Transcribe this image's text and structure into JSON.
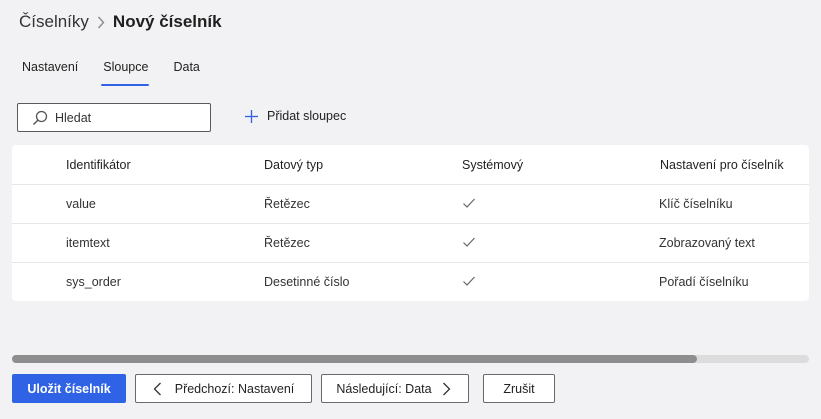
{
  "breadcrumb": {
    "parent": "Číselníky",
    "current": "Nový číselník"
  },
  "tabs": [
    {
      "label": "Nastavení",
      "active": false
    },
    {
      "label": "Sloupce",
      "active": true
    },
    {
      "label": "Data",
      "active": false
    }
  ],
  "toolbar": {
    "search_placeholder": "Hledat",
    "search_value": "",
    "add_column_label": "Přidat sloupec"
  },
  "table": {
    "headers": [
      "Identifikátor",
      "Datový typ",
      "Systémový",
      "Nastavení pro číselník"
    ],
    "rows": [
      {
        "identifier": "value",
        "type": "Řetězec",
        "system": true,
        "setting": "Klíč číselníku"
      },
      {
        "identifier": "itemtext",
        "type": "Řetězec",
        "system": true,
        "setting": "Zobrazovaný text"
      },
      {
        "identifier": "sys_order",
        "type": "Desetinné číslo",
        "system": true,
        "setting": "Pořadí číselníku"
      }
    ]
  },
  "scrollbar": {
    "horizontal_position": 0,
    "visible_fraction": 0.86
  },
  "footer": {
    "save_label": "Uložit číselník",
    "prev_label": "Předchozí: Nastavení",
    "next_label": "Následující: Data",
    "cancel_label": "Zrušit"
  },
  "colors": {
    "accent": "#2f62e5",
    "background": "#f2f2f4"
  },
  "icons": {
    "search": "search-icon",
    "add": "plus-icon",
    "check": "check-icon",
    "chevron_left": "chevron-left-icon",
    "chevron_right": "chevron-right-icon",
    "breadcrumb_sep": "chevron-right-icon"
  }
}
